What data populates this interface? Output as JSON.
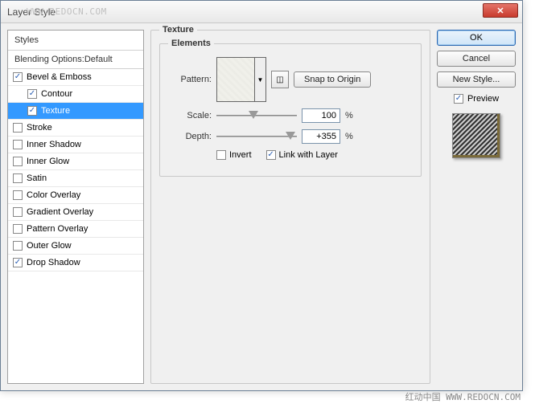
{
  "window": {
    "title": "Layer Style",
    "watermark_top": "WWW.REDOCN.COM",
    "close": "✕"
  },
  "styles": {
    "header": "Styles",
    "blending": "Blending Options:Default",
    "items": [
      {
        "label": "Bevel & Emboss",
        "checked": true,
        "indent": false,
        "selected": false
      },
      {
        "label": "Contour",
        "checked": true,
        "indent": true,
        "selected": false
      },
      {
        "label": "Texture",
        "checked": true,
        "indent": true,
        "selected": true
      },
      {
        "label": "Stroke",
        "checked": false,
        "indent": false,
        "selected": false
      },
      {
        "label": "Inner Shadow",
        "checked": false,
        "indent": false,
        "selected": false
      },
      {
        "label": "Inner Glow",
        "checked": false,
        "indent": false,
        "selected": false
      },
      {
        "label": "Satin",
        "checked": false,
        "indent": false,
        "selected": false
      },
      {
        "label": "Color Overlay",
        "checked": false,
        "indent": false,
        "selected": false
      },
      {
        "label": "Gradient Overlay",
        "checked": false,
        "indent": false,
        "selected": false
      },
      {
        "label": "Pattern Overlay",
        "checked": false,
        "indent": false,
        "selected": false
      },
      {
        "label": "Outer Glow",
        "checked": false,
        "indent": false,
        "selected": false
      },
      {
        "label": "Drop Shadow",
        "checked": true,
        "indent": false,
        "selected": false
      }
    ]
  },
  "texture": {
    "group_label": "Texture",
    "elements_label": "Elements",
    "pattern_label": "Pattern:",
    "snap_label": "Snap to Origin",
    "scale_label": "Scale:",
    "scale_value": "100",
    "scale_unit": "%",
    "depth_label": "Depth:",
    "depth_value": "+355",
    "depth_unit": "%",
    "invert_label": "Invert",
    "invert_checked": false,
    "link_label": "Link with Layer",
    "link_checked": true
  },
  "right": {
    "ok": "OK",
    "cancel": "Cancel",
    "new_style": "New Style...",
    "preview": "Preview",
    "preview_checked": true
  },
  "watermark_bottom": "红动中国 WWW.REDOCN.COM"
}
